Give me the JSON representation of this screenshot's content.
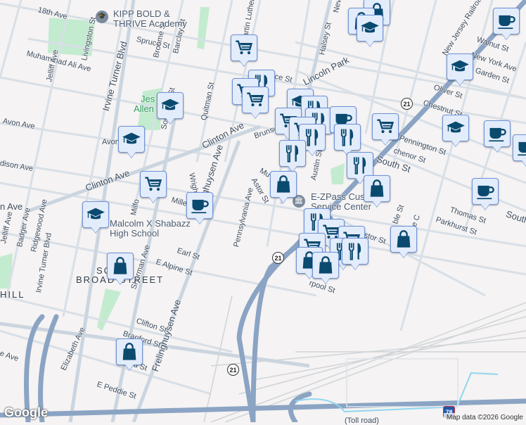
{
  "map": {
    "streets": {
      "ave18": "18th Ave",
      "muhammad_ali": "Muhammad Ali Ave",
      "avon1": "Avon Ave",
      "avon2": "Avon",
      "madison": "dison Ave",
      "clinton1": "Clinton Ave",
      "clinton2": "Clinton Ave",
      "ave_left": "n Ave",
      "livingston": "Livingston St",
      "irvine1": "Irvine Turner Blvd",
      "irvine2": "Irvine Turner Blvd",
      "jelliff1": "Jelliff Ave",
      "jelliff2": "Jelliff Ave",
      "badger": "Badger Ave",
      "ridgewood": "Ridgewood Ave",
      "spruce": "Spruce St",
      "broome": "Broome St",
      "barclay": "Barclay St",
      "somerset": "Somerset St",
      "quitman": "Quitman St",
      "wright": "Wright St",
      "milford": "Milfo",
      "miller": "Mille",
      "frelinghuysen1": "Frelinghuysen Ave",
      "frelinghuysen2": "Frelinghuysen Ave",
      "pennsylvania": "Pennsylvania Ave",
      "astor": "Astor St",
      "mlk": "Dr Martin Luther",
      "spruce2": "Spruce St",
      "brunswick": "Brunsw",
      "mu": "Mu",
      "nevada": "Neva",
      "halsey": "Halsey St",
      "austin": "Austin St",
      "lincoln_park": "Lincoln Park",
      "nj_railroad": "New Jersey Railroad A",
      "walnut": "Walnut St",
      "new_york": "New York Ave",
      "garden": "Garden St",
      "oliver": "Oliver St",
      "chestnut": "Chestnut St",
      "pennington": "Pennington St",
      "chenor": "chenor St",
      "south": "South St",
      "south2": "South",
      "thomas": "Thomas St",
      "parkhurst": "Parkhurst St",
      "avenue_c": "Avenue C",
      "ble": "ble St",
      "astor2": "stor St",
      "liverpool": "rpool St",
      "earl": "Earl St",
      "alpine": "E Alpine St",
      "sherman": "Sherman Ave",
      "clifton": "Clifton St",
      "branford": "Branford St",
      "ford": "ford St",
      "elizabeth": "Elizabeth Ave",
      "peddie": "E Peddie St",
      "shabazz_ave": "e Ave",
      "ave_jo": "Jo",
      "ave_e": "E"
    },
    "route_shields": [
      "21",
      "21",
      "21"
    ],
    "interstate": "78",
    "tollroad": "(Toll road)",
    "neighborhoods": {
      "south_broad": "SOUTH BROAD STREET",
      "south_broad_l1": "SO",
      "south_broad_l2": "BROAD STREET",
      "hill": "HILL"
    },
    "pois": {
      "kipp": "KIPP BOLD & THRIVE Academy",
      "kipp_l1": "KIPP BOLD &",
      "kipp_l2": "THRIVE Academy",
      "jesse": "Jesse Allen Park",
      "jesse_l1": "Jes",
      "jesse_l2": "Allen",
      "shabazz_l1": "Malcolm X Shabazz",
      "shabazz_l2": "High School",
      "ezpass_l1": "E-ZPass Cus",
      "ezpass_l2": "Service Center"
    },
    "markers": [
      "cart",
      "school",
      "school",
      "cart",
      "cup",
      "school",
      "bag",
      "bag",
      "restaurant",
      "cart",
      "cart",
      "bag",
      "bag",
      "school",
      "cup",
      "school",
      "school",
      "cup",
      "cup",
      "cup",
      "school",
      "restaurant",
      "cart",
      "restaurant",
      "cart",
      "cup",
      "restaurant",
      "restaurant",
      "cart",
      "restaurant",
      "restaurant",
      "bag",
      "bag",
      "restaurant",
      "cart",
      "cart",
      "cart",
      "restaurant",
      "restaurant",
      "bag",
      "bag",
      "bag"
    ]
  },
  "footer": {
    "google": "Google",
    "attribution": "Map data ©2026 Google"
  },
  "colors": {
    "highway": "#8ba4c4",
    "road": "#d5dde6",
    "park": "#c3ebcf",
    "marker_bg": "#e3ecfb",
    "icon": "#0b4a6f",
    "water": "#8fd6ef"
  }
}
